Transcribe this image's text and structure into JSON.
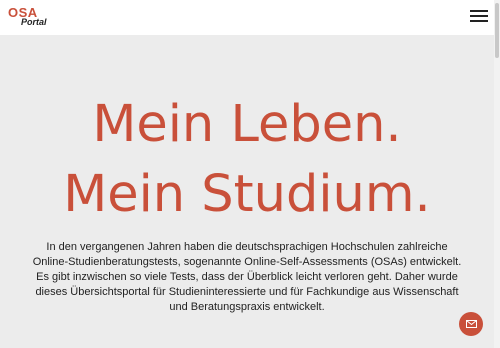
{
  "logo": {
    "line1": "OSA",
    "line2": "Portal"
  },
  "hero": {
    "line1": "Mein Leben.",
    "line2": "Mein Studium.",
    "intro": "In den vergangenen Jahren haben die deutschsprachigen Hochschulen zahlreiche Online-Studienberatungstests, sogenannte Online-Self-Assessments (OSAs) entwickelt. Es gibt inzwischen so viele Tests, dass der Überblick leicht verloren geht. Daher wurde dieses Übersichtsportal für Studieninteressierte und für Fachkundige aus Wissenschaft und Beratungspraxis entwickelt."
  },
  "icons": {
    "menu": "hamburger-menu-icon",
    "contact": "mail-icon"
  },
  "colors": {
    "accent": "#c9503a",
    "background": "#ececec",
    "header": "#ffffff"
  }
}
